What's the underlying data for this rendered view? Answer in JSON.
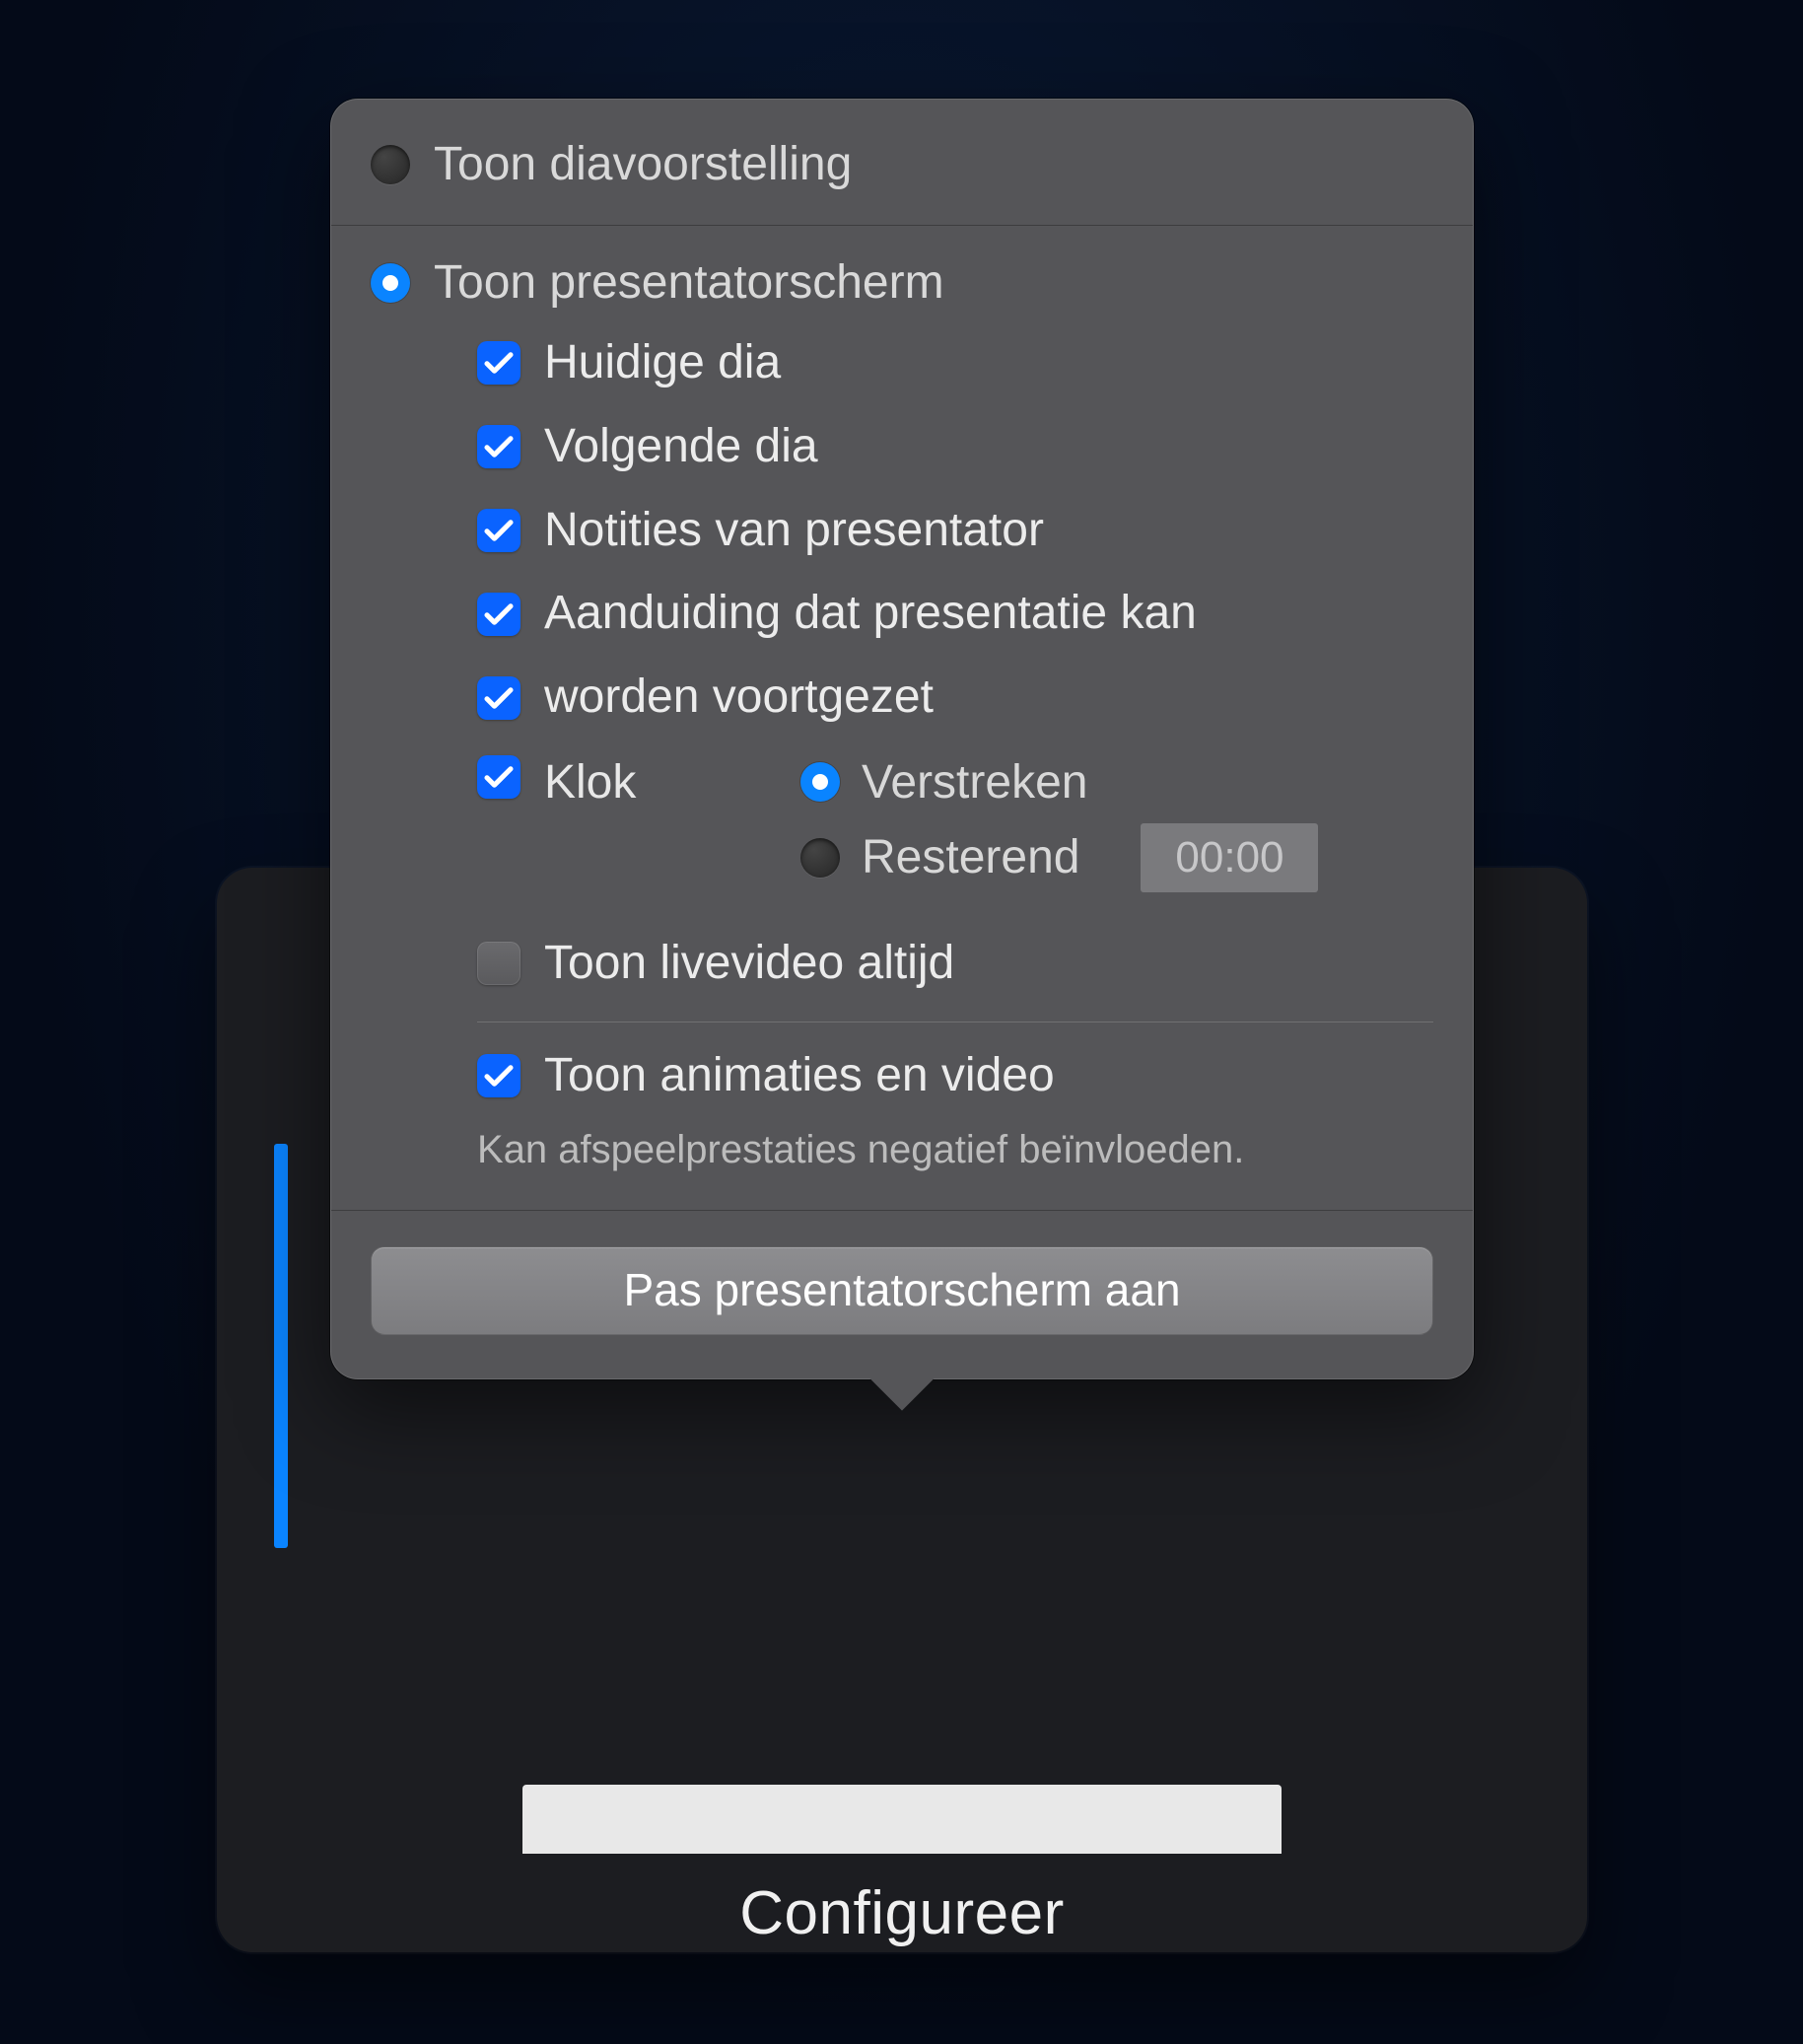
{
  "background": {
    "configure_label": "Configureer"
  },
  "popover": {
    "radios": {
      "slideshow": {
        "label": "Toon diavoorstelling",
        "selected": false
      },
      "presenter": {
        "label": "Toon presentatorscherm",
        "selected": true
      }
    },
    "options": {
      "current_slide": {
        "label": "Huidige dia",
        "checked": true
      },
      "next_slide": {
        "label": "Volgende dia",
        "checked": true
      },
      "presenter_notes": {
        "label": "Notities van presentator",
        "checked": true
      },
      "advance_line1": {
        "label": "Aanduiding dat presentatie kan",
        "checked": true
      },
      "advance_line2": {
        "label": "worden voortgezet",
        "checked": true
      },
      "clock": {
        "label": "Klok",
        "checked": true
      },
      "clock_modes": {
        "elapsed": {
          "label": "Verstreken",
          "selected": true
        },
        "remaining": {
          "label": "Resterend",
          "selected": false,
          "time_value": "00:00"
        }
      },
      "live_video": {
        "label": "Toon livevideo altijd",
        "checked": false
      },
      "animations": {
        "label": "Toon animaties en video",
        "checked": true
      },
      "animations_hint": "Kan afspeelprestaties negatief beïnvloeden."
    },
    "apply_button": "Pas presentatorscherm aan"
  }
}
